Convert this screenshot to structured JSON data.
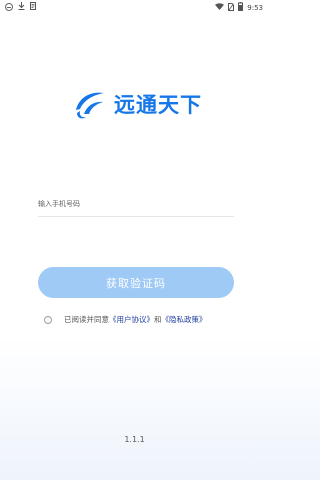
{
  "status_bar": {
    "time": "9:53",
    "left_icons": [
      "dnd-icon",
      "download-icon",
      "notification-icon"
    ],
    "right_icons": [
      "wifi-icon",
      "sim-icon",
      "battery-icon"
    ]
  },
  "brand": {
    "name": "远通天下",
    "logo_icon": "brand-swoosh-logo",
    "color": "#1677e8"
  },
  "login_form": {
    "phone_placeholder": "输入手机号码",
    "phone_value": "",
    "get_code_label": "获取验证码",
    "button_color": "#9fcaf6"
  },
  "agreement": {
    "checked": false,
    "prefix": "已阅读并同意",
    "user_agreement": "《用户协议》",
    "conjunction": "和",
    "privacy_policy": "《隐私政策》"
  },
  "app_version": "1.1.1"
}
